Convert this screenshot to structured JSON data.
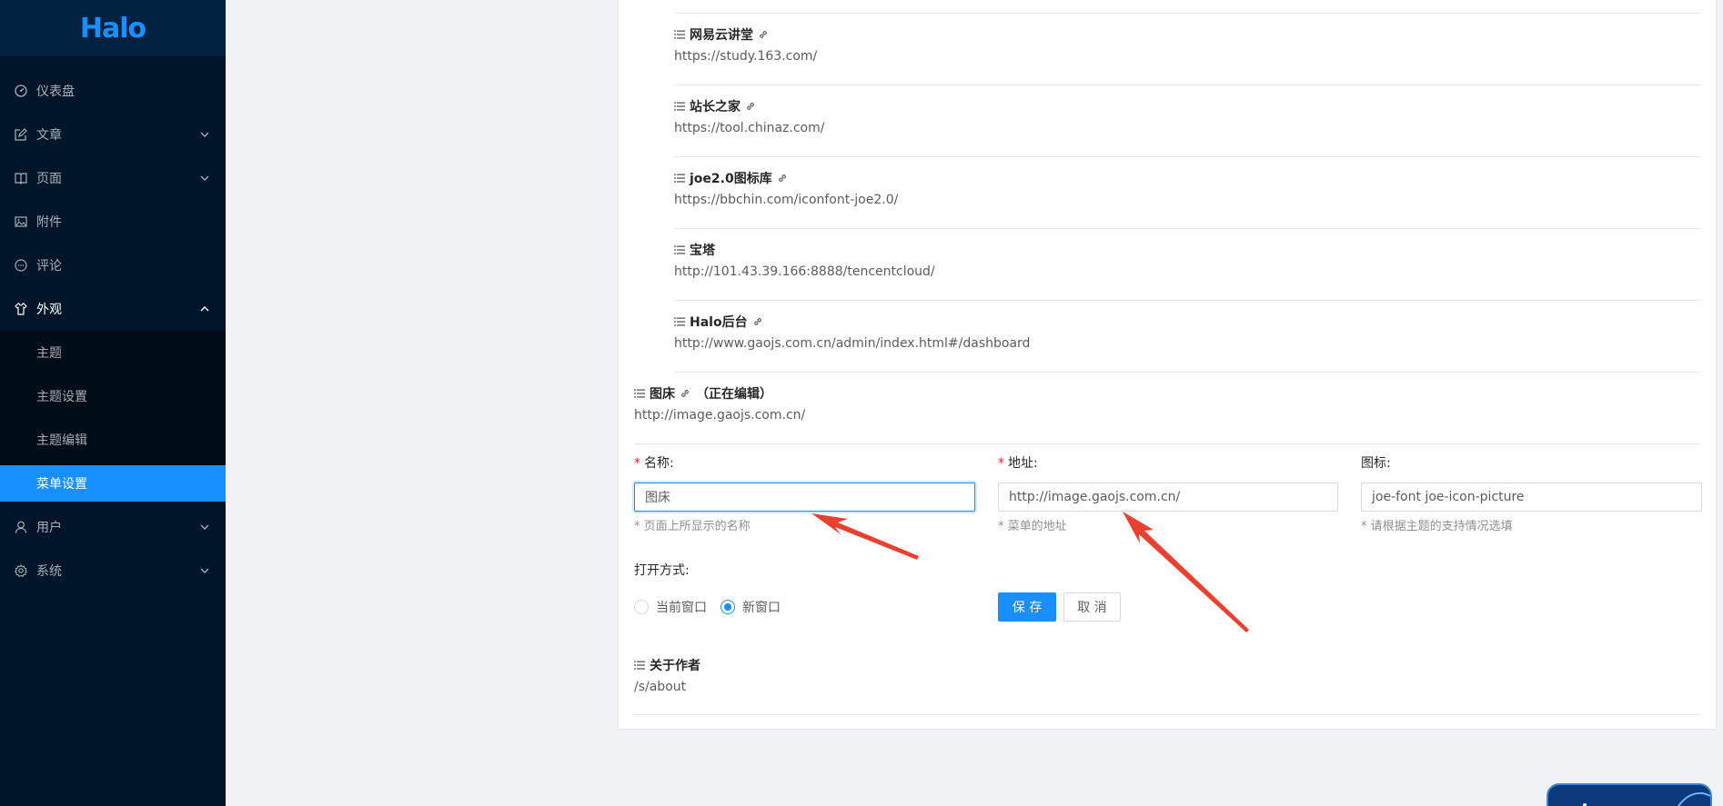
{
  "app": {
    "logo": "Halo"
  },
  "sidebar": {
    "items": [
      {
        "label": "仪表盘",
        "icon": "dashboard-icon"
      },
      {
        "label": "文章",
        "icon": "form-icon"
      },
      {
        "label": "页面",
        "icon": "read-icon"
      },
      {
        "label": "附件",
        "icon": "picture-icon"
      },
      {
        "label": "评论",
        "icon": "message-icon"
      },
      {
        "label": "外观",
        "icon": "skin-icon"
      },
      {
        "label": "用户",
        "icon": "user-icon"
      },
      {
        "label": "系统",
        "icon": "setting-icon"
      }
    ],
    "submenu": [
      {
        "label": "主题"
      },
      {
        "label": "主题设置"
      },
      {
        "label": "主题编辑"
      },
      {
        "label": "菜单设置"
      }
    ]
  },
  "menu_links": [
    {
      "name": "网易云讲堂",
      "url": "https://study.163.com/"
    },
    {
      "name": "站长之家",
      "url": "https://tool.chinaz.com/"
    },
    {
      "name": "joe2.0图标库",
      "url": "https://bbchin.com/iconfont-joe2.0/"
    },
    {
      "name": "宝塔",
      "url": "http://101.43.39.166:8888/tencentcloud/"
    },
    {
      "name": "Halo后台",
      "url": "http://www.gaojs.com.cn/admin/index.html#/dashboard"
    }
  ],
  "editing": {
    "name": "图床",
    "tag": "（正在编辑）",
    "url": "http://image.gaojs.com.cn/"
  },
  "form": {
    "name_label": "名称:",
    "name_value": "图床",
    "name_help": "* 页面上所显示的名称",
    "url_label": "地址:",
    "url_value": "http://image.gaojs.com.cn/",
    "url_help": "* 菜单的地址",
    "icon_label": "图标:",
    "icon_value": "joe-font joe-icon-picture",
    "icon_help": "* 请根据主题的支持情况选填",
    "open_label": "打开方式:",
    "open_options": [
      "当前窗口",
      "新窗口"
    ],
    "open_selected": "新窗口",
    "save_label": "保 存",
    "cancel_label": "取 消"
  },
  "after_link": {
    "name": "关于作者",
    "url": "/s/about"
  },
  "colors": {
    "primary": "#1890ff",
    "sidebar": "#001529",
    "annotation_arrow": "#e8412f"
  }
}
